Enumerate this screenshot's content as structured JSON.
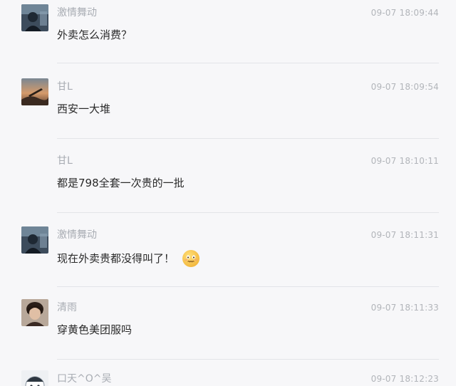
{
  "messages": [
    {
      "name": "激情舞动",
      "time": "09-07 18:09:44",
      "text": "外卖怎么消费？",
      "avatar": "dark-photo"
    },
    {
      "name": "甘L",
      "time": "09-07 18:09:54",
      "text": "西安一大堆",
      "avatar": "sunset-photo"
    },
    {
      "name": "甘L",
      "time": "09-07 18:10:11",
      "text": "都是798全套一次贵的一批",
      "avatar": "none"
    },
    {
      "name": "激情舞动",
      "time": "09-07 18:11:31",
      "text": "现在外卖贵都没得叫了！",
      "avatar": "dark-photo",
      "emoji": "nervous-face-emoji"
    },
    {
      "name": "清雨",
      "time": "09-07 18:11:33",
      "text": "穿黄色美团服吗",
      "avatar": "portrait-photo"
    },
    {
      "name": "口天^O^吴",
      "time": "09-07 18:12:23",
      "text": "",
      "avatar": "cartoon-face"
    }
  ]
}
